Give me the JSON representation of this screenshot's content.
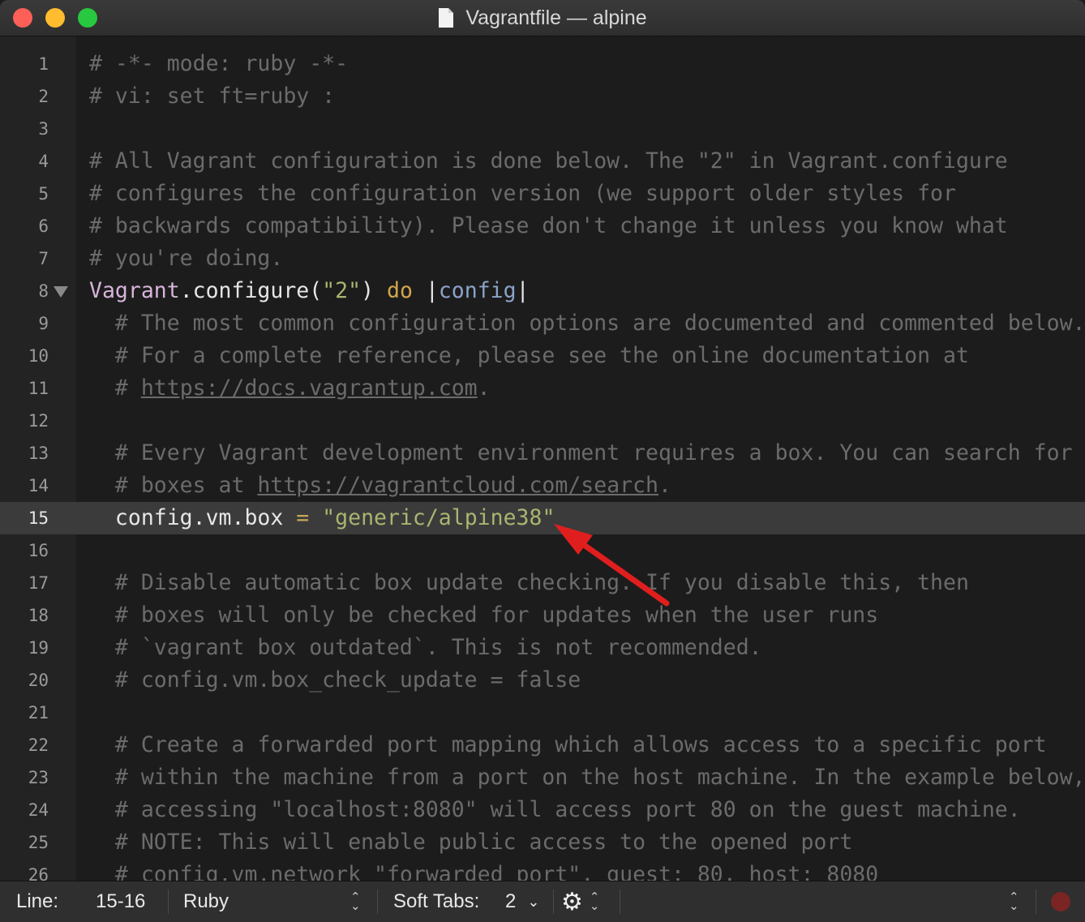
{
  "window": {
    "title": "Vagrantfile — alpine",
    "file_icon": "document-icon"
  },
  "editor": {
    "current_line": 15,
    "lines": [
      {
        "n": "1",
        "tokens": [
          [
            "c-comment",
            "# -*- mode: ruby -*-"
          ]
        ]
      },
      {
        "n": "2",
        "tokens": [
          [
            "c-comment",
            "# vi: set ft=ruby :"
          ]
        ]
      },
      {
        "n": "3",
        "tokens": []
      },
      {
        "n": "4",
        "tokens": [
          [
            "c-comment",
            "# All Vagrant configuration is done below. The \"2\" in Vagrant.configure"
          ]
        ]
      },
      {
        "n": "5",
        "tokens": [
          [
            "c-comment",
            "# configures the configuration version (we support older styles for"
          ]
        ]
      },
      {
        "n": "6",
        "tokens": [
          [
            "c-comment",
            "# backwards compatibility). Please don't change it unless you know what"
          ]
        ]
      },
      {
        "n": "7",
        "tokens": [
          [
            "c-comment",
            "# you're doing."
          ]
        ]
      },
      {
        "n": "8",
        "fold": true,
        "tokens": [
          [
            "c-const",
            "Vagrant"
          ],
          [
            "c-plain",
            ".configure("
          ],
          [
            "c-str",
            "\"2\""
          ],
          [
            "c-plain",
            ") "
          ],
          [
            "c-kw",
            "do"
          ],
          [
            "c-plain",
            " |"
          ],
          [
            "c-var",
            "config"
          ],
          [
            "c-plain",
            "|"
          ]
        ]
      },
      {
        "n": "9",
        "tokens": [
          [
            "c-comment",
            "  # The most common configuration options are documented and commented below."
          ]
        ]
      },
      {
        "n": "10",
        "tokens": [
          [
            "c-comment",
            "  # For a complete reference, please see the online documentation at"
          ]
        ]
      },
      {
        "n": "11",
        "tokens": [
          [
            "c-comment",
            "  # "
          ],
          [
            "c-link",
            "https://docs.vagrantup.com"
          ],
          [
            "c-comment",
            "."
          ]
        ]
      },
      {
        "n": "12",
        "tokens": []
      },
      {
        "n": "13",
        "tokens": [
          [
            "c-comment",
            "  # Every Vagrant development environment requires a box. You can search for"
          ]
        ]
      },
      {
        "n": "14",
        "tokens": [
          [
            "c-comment",
            "  # boxes at "
          ],
          [
            "c-link",
            "https://vagrantcloud.com/search"
          ],
          [
            "c-comment",
            "."
          ]
        ]
      },
      {
        "n": "15",
        "tokens": [
          [
            "c-plain",
            "  config.vm.box "
          ],
          [
            "c-op",
            "="
          ],
          [
            "c-plain",
            " "
          ],
          [
            "c-str",
            "\"generic/alpine38\""
          ]
        ]
      },
      {
        "n": "16",
        "tokens": []
      },
      {
        "n": "17",
        "tokens": [
          [
            "c-comment",
            "  # Disable automatic box update checking. If you disable this, then"
          ]
        ]
      },
      {
        "n": "18",
        "tokens": [
          [
            "c-comment",
            "  # boxes will only be checked for updates when the user runs"
          ]
        ]
      },
      {
        "n": "19",
        "tokens": [
          [
            "c-comment",
            "  # `vagrant box outdated`. This is not recommended."
          ]
        ]
      },
      {
        "n": "20",
        "tokens": [
          [
            "c-comment",
            "  # config.vm.box_check_update = false"
          ]
        ]
      },
      {
        "n": "21",
        "tokens": []
      },
      {
        "n": "22",
        "tokens": [
          [
            "c-comment",
            "  # Create a forwarded port mapping which allows access to a specific port"
          ]
        ]
      },
      {
        "n": "23",
        "tokens": [
          [
            "c-comment",
            "  # within the machine from a port on the host machine. In the example below,"
          ]
        ]
      },
      {
        "n": "24",
        "tokens": [
          [
            "c-comment",
            "  # accessing \"localhost:8080\" will access port 80 on the guest machine."
          ]
        ]
      },
      {
        "n": "25",
        "tokens": [
          [
            "c-comment",
            "  # NOTE: This will enable public access to the opened port"
          ]
        ]
      },
      {
        "n": "26",
        "tokens": [
          [
            "c-comment",
            "  # config.vm.network \"forwarded_port\", guest: 80, host: 8080"
          ]
        ]
      }
    ]
  },
  "statusbar": {
    "line_label": "Line:",
    "line_value": "15-16",
    "language": "Ruby",
    "tabs_label": "Soft Tabs:",
    "tabs_value": "2",
    "settings_icon": "gear-icon",
    "record_icon": "record-macro-icon"
  },
  "annotation": {
    "arrow_color": "#e01e1e",
    "points_to_line": 15
  }
}
